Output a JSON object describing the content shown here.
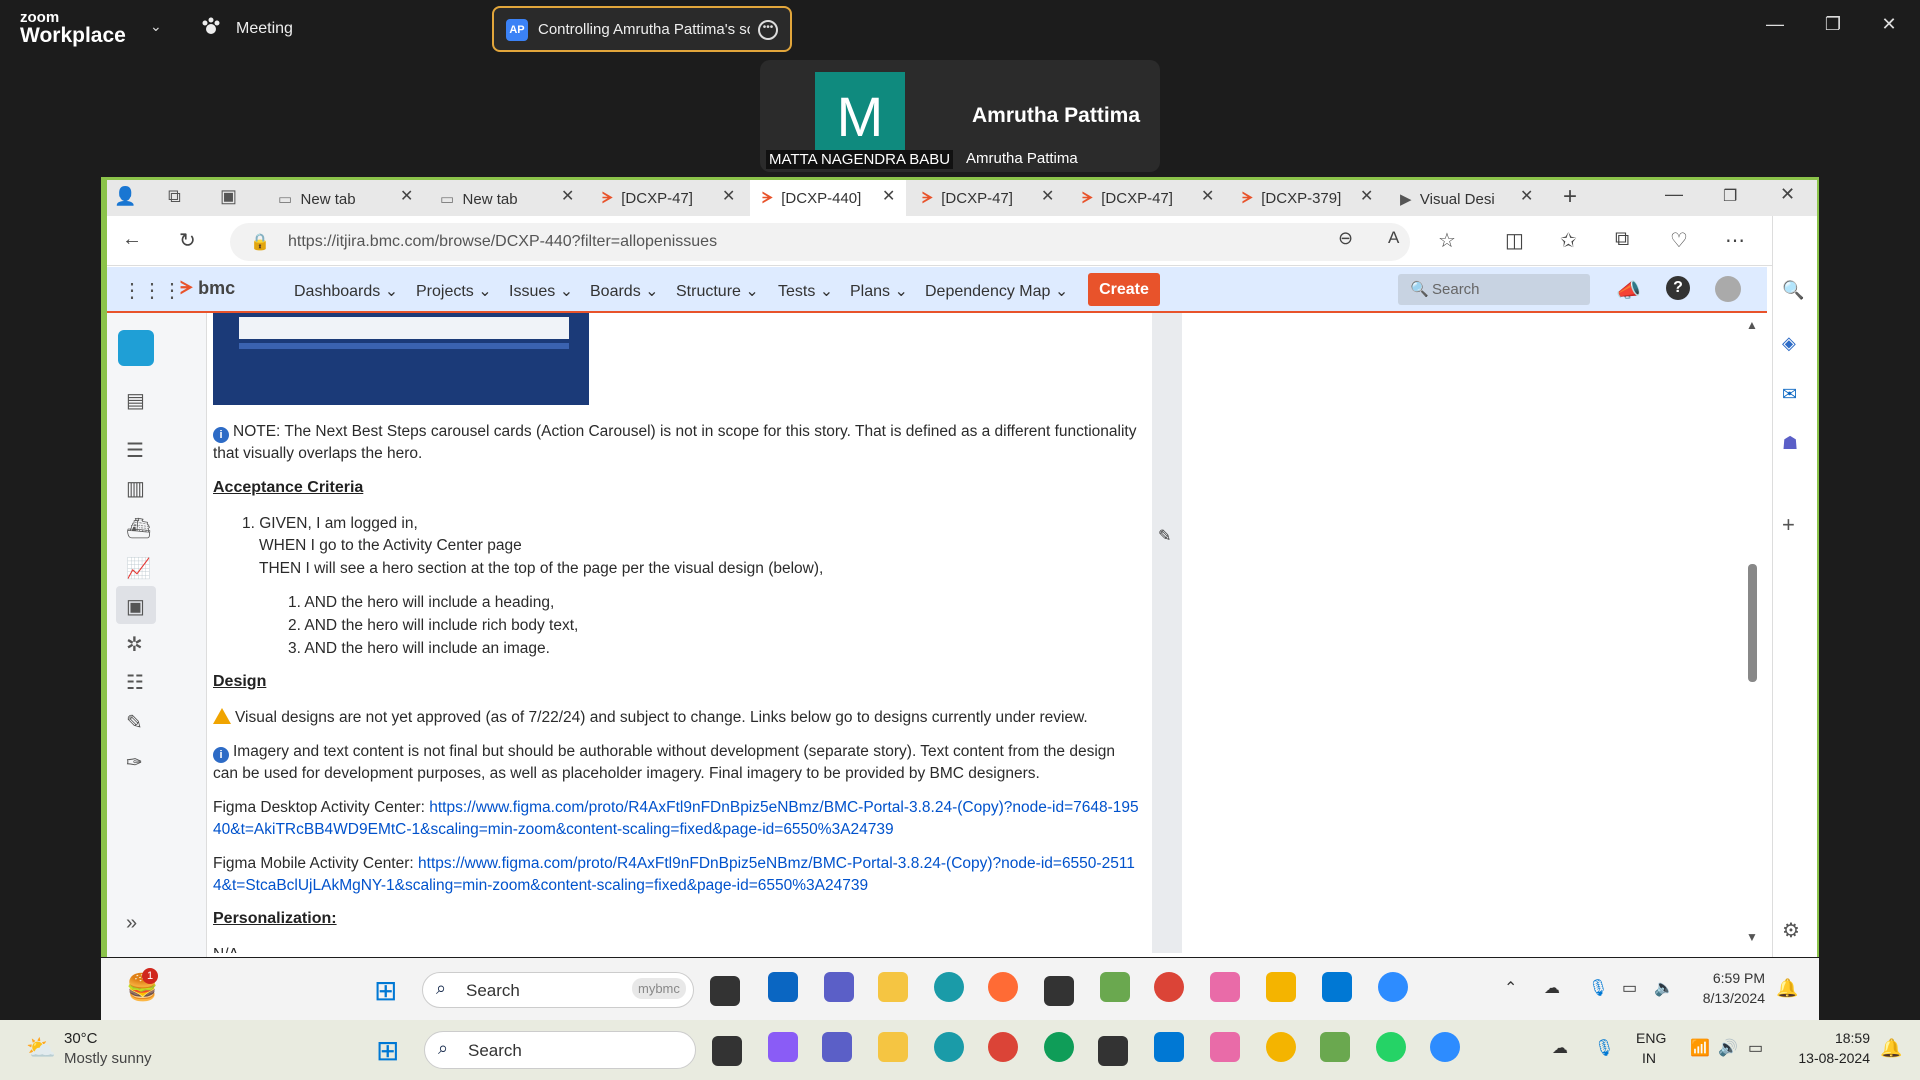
{
  "zoom": {
    "brand_small": "zoom",
    "brand_big": "Workplace",
    "meeting_label": "Meeting",
    "control_initials": "AP",
    "control_text": "Controlling Amrutha Pattima's sc",
    "participant_initial": "M",
    "participant_name": "Amrutha Pattima",
    "label_left": "MATTA NAGENDRA BABU",
    "label_right": "Amrutha Pattima"
  },
  "browser": {
    "tabs": [
      {
        "label": "New tab"
      },
      {
        "label": "New tab"
      },
      {
        "label": "[DCXP-47]"
      },
      {
        "label": "[DCXP-440]"
      },
      {
        "label": "[DCXP-47]"
      },
      {
        "label": "[DCXP-47]"
      },
      {
        "label": "[DCXP-379]"
      },
      {
        "label": "Visual Desi"
      }
    ],
    "url": "https://itjira.bmc.com/browse/DCXP-440?filter=allopenissues"
  },
  "jira": {
    "logo": "bmc",
    "menu": [
      "Dashboards",
      "Projects",
      "Issues",
      "Boards",
      "Structure",
      "Tests",
      "Plans",
      "Dependency Map"
    ],
    "create": "Create",
    "search_placeholder": "Search"
  },
  "content": {
    "note": "NOTE: The Next Best Steps carousel cards (Action Carousel) is not in scope for this story. That is defined as a different functionality that visually overlaps the hero.",
    "acceptance_heading": "Acceptance Criteria",
    "ac_given": "1. GIVEN, I am logged in,",
    "ac_when": "WHEN I go to the Activity Center page",
    "ac_then": "THEN I will see a hero section at the top of the page per the visual design (below),",
    "ac_items": [
      "1. AND the hero will include a heading,",
      "2. AND the hero will include rich body text,",
      "3. AND the hero will include an image."
    ],
    "design_heading": "Design",
    "design_warn": "Visual designs are not yet approved (as of 7/22/24) and subject to change. Links below go to designs currently under review.",
    "design_info": "Imagery and text content is not final but should be authorable without development (separate story). Text content from the design can be used for development purposes, as well as placeholder imagery. Final imagery to be provided by BMC designers.",
    "figma_desktop_label": "Figma Desktop Activity Center: ",
    "figma_desktop_link": "https://www.figma.com/proto/R4AxFtl9nFDnBpiz5eNBmz/BMC-Portal-3.8.24-(Copy)?node-id=7648-19540&t=AkiTRcBB4WD9EMtC-1&scaling=min-zoom&content-scaling=fixed&page-id=6550%3A24739",
    "figma_mobile_label": "Figma Mobile Activity Center: ",
    "figma_mobile_link": "https://www.figma.com/proto/R4AxFtl9nFDnBpiz5eNBmz/BMC-Portal-3.8.24-(Copy)?node-id=6550-25114&t=StcaBclUjLAkMgNY-1&scaling=min-zoom&content-scaling=fixed&page-id=6550%3A24739",
    "personalization_heading": "Personalization:",
    "cut_text": "N/A"
  },
  "taskbar_remote": {
    "search": "Search",
    "mybmc": "mybmc",
    "time": "6:59 PM",
    "date": "8/13/2024",
    "badge": "1"
  },
  "taskbar_local": {
    "temp": "30°C",
    "weather": "Mostly sunny",
    "search": "Search",
    "lang1": "ENG",
    "lang2": "IN",
    "time": "18:59",
    "date": "13-08-2024"
  },
  "colors": {
    "accent_green": "#8bc34a",
    "bmc_orange": "#e8532b",
    "link": "#0052cc"
  }
}
